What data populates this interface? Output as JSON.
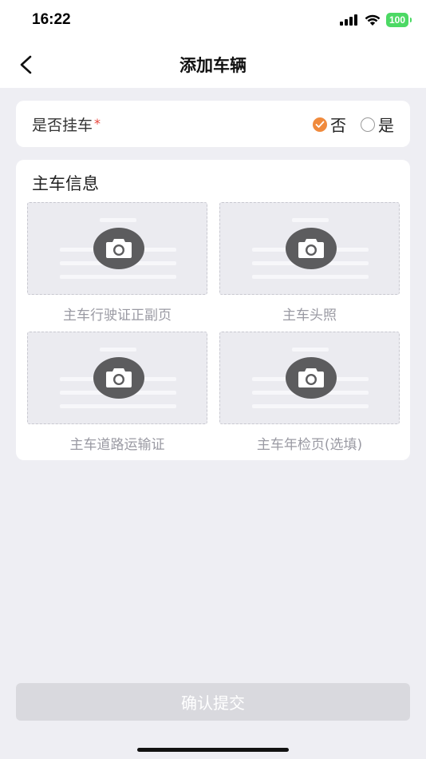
{
  "status_bar": {
    "time": "16:22",
    "battery": "100"
  },
  "nav": {
    "title": "添加车辆"
  },
  "trailer": {
    "label": "是否挂车",
    "required_mark": "*",
    "options": [
      {
        "label": "否",
        "selected": true
      },
      {
        "label": "是",
        "selected": false
      }
    ]
  },
  "main_info": {
    "title": "主车信息",
    "tiles": [
      {
        "label": "主车行驶证正副页"
      },
      {
        "label": "主车头照"
      },
      {
        "label": "主车道路运输证"
      },
      {
        "label": "主车年检页(选填)"
      }
    ]
  },
  "submit": {
    "label": "确认提交"
  },
  "colors": {
    "accent": "#f08a3c",
    "required": "#e8443a",
    "disabled_button": "#d9d9de"
  }
}
